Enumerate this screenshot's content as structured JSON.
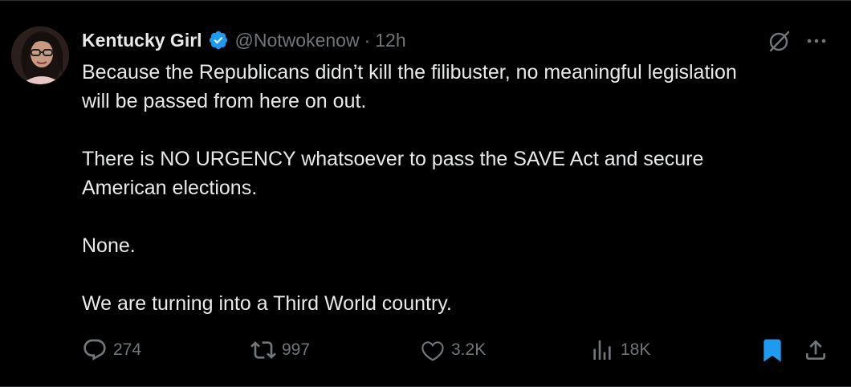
{
  "user": {
    "display_name": "Kentucky Girl",
    "handle": "@Notwokenow",
    "separator": "·",
    "time": "12h",
    "verified": true
  },
  "tweet": {
    "paragraphs": [
      "Because the Republicans didn’t kill the filibuster, no meaningful legislation\nwill be passed from here on out.",
      "There is NO URGENCY whatsoever to pass the SAVE Act and secure\nAmerican elections.",
      "None.",
      "We are turning into a Third World country."
    ]
  },
  "actions": {
    "replies": "274",
    "reposts": "997",
    "likes": "3.2K",
    "views": "18K"
  },
  "icons": {
    "verified": "verified-badge-icon",
    "grok": "grok-icon",
    "more": "more-icon",
    "reply": "reply-icon",
    "repost": "repost-icon",
    "like": "heart-icon",
    "views": "views-icon",
    "bookmark": "bookmark-icon",
    "share": "share-icon"
  },
  "colors": {
    "background": "#000000",
    "text": "#e7e9ea",
    "muted": "#71767b",
    "accent": "#1d9bf0"
  }
}
